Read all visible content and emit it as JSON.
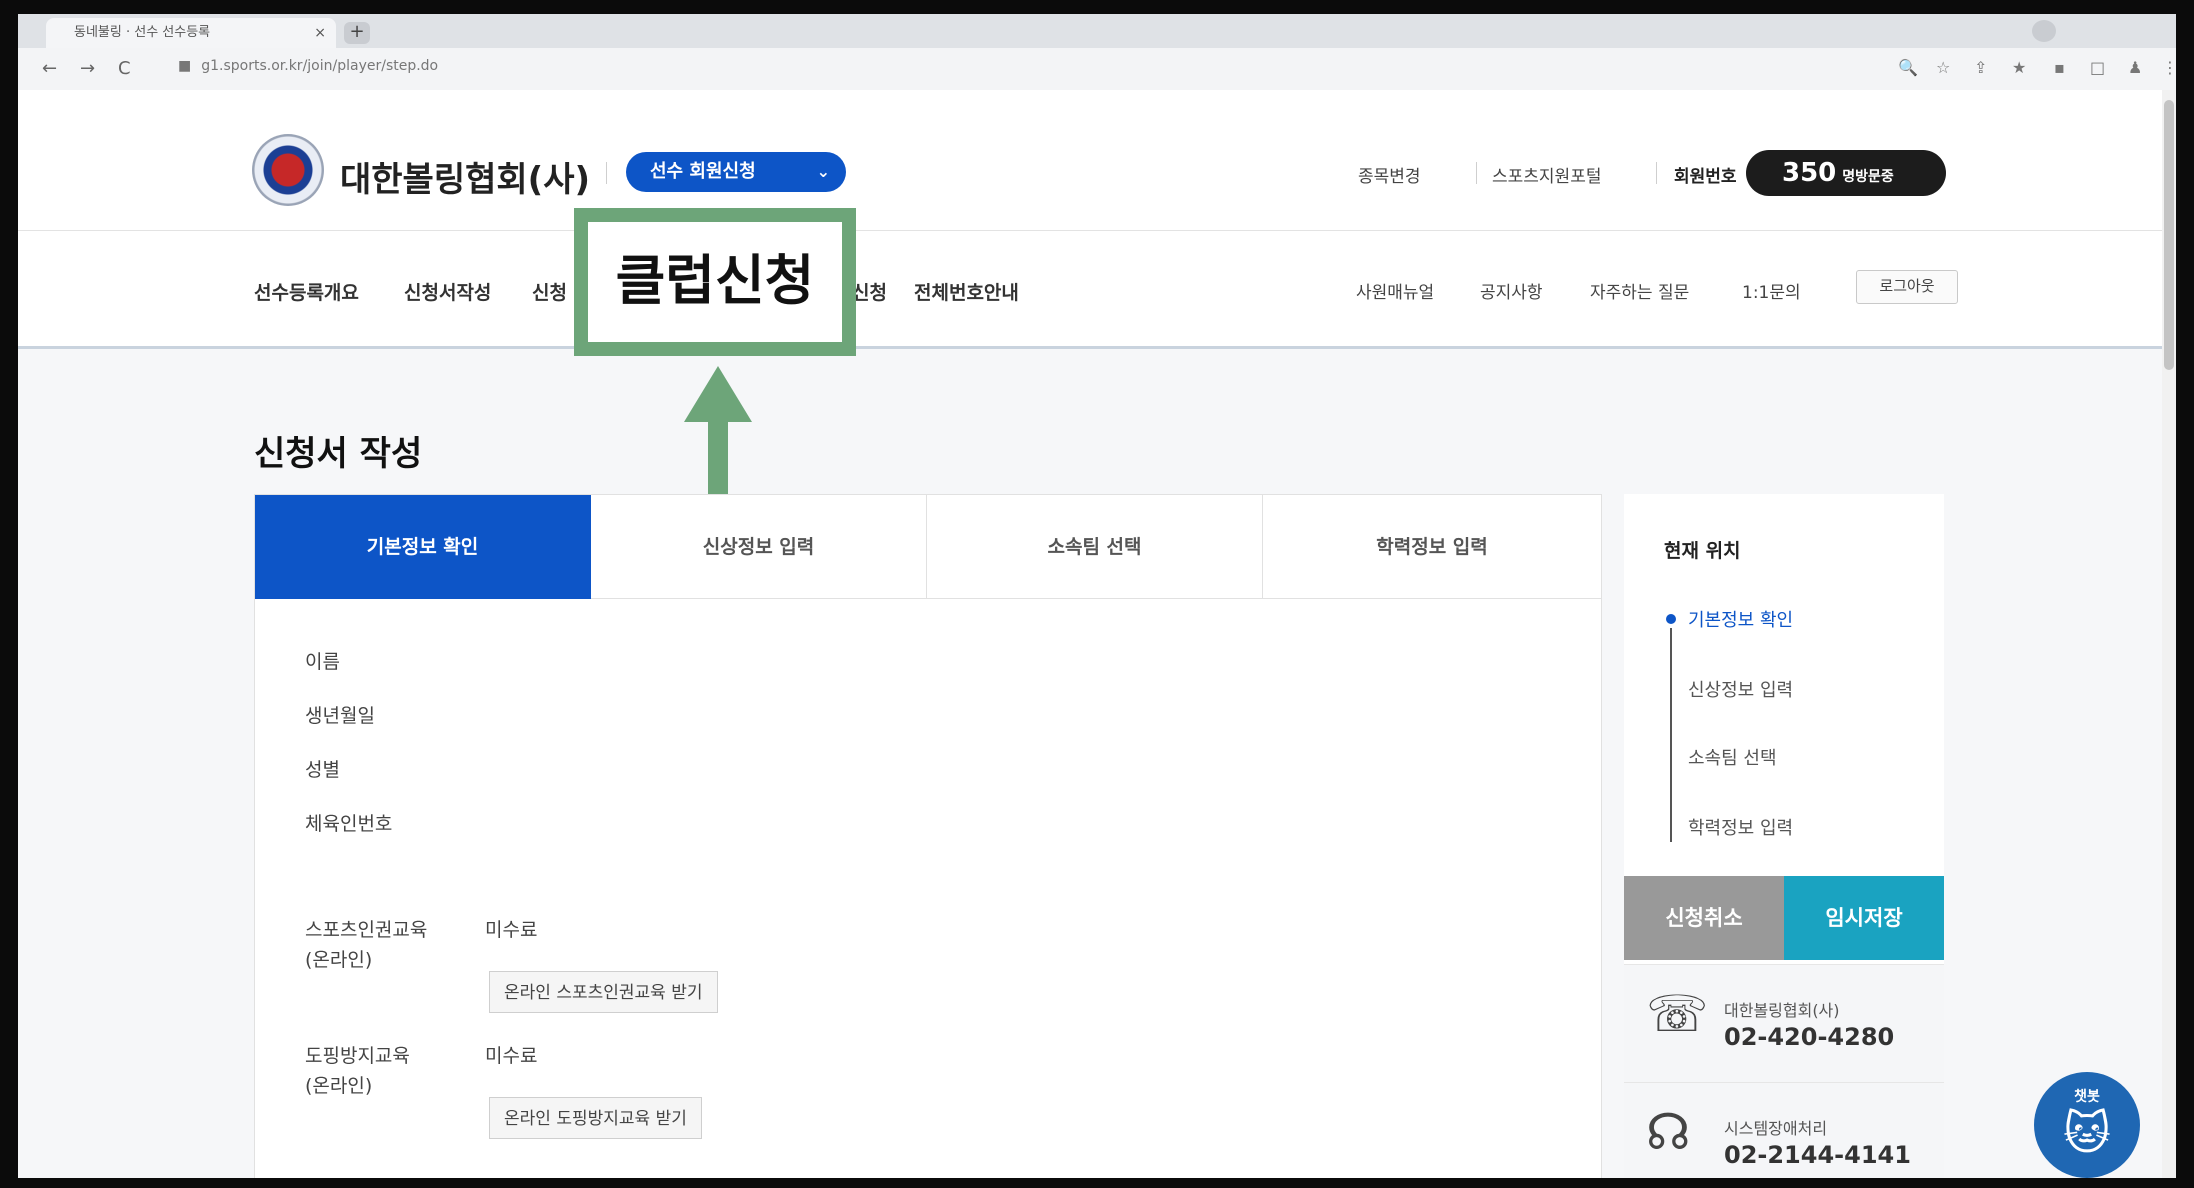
{
  "browser": {
    "tab_title": "동네불링 · 선수 선수등록",
    "tab_close": "×",
    "new_tab": "+",
    "back": "←",
    "forward": "→",
    "reload": "C",
    "lock": "■",
    "url": "g1.sports.or.kr/join/player/step.do",
    "toolbar_icons": [
      "🔍",
      "☆",
      "⇪",
      "★",
      "▪",
      "□",
      "♟",
      "⋮"
    ]
  },
  "header": {
    "site_title": "대한볼링협회(사)",
    "member_select": "선수 회원신청",
    "member_select_chevron": "⌄",
    "util_links": [
      "종목변경",
      "스포츠지원포털"
    ],
    "member_label": "회원번호",
    "visit_count": "350",
    "visit_label": "명방문중"
  },
  "nav": {
    "items": [
      "선수등록개요",
      "신청서작성",
      "신청",
      "신청",
      "전체번호안내"
    ],
    "right_links": [
      "사원매뉴얼",
      "공지사항",
      "자주하는 질문",
      "1:1문의"
    ],
    "logout": "로그아웃"
  },
  "callout": {
    "text": "클럽신청"
  },
  "page_heading": "신청서 작성",
  "steps": [
    "기본정보 확인",
    "신상정보 입력",
    "소속팀 선택",
    "학력정보 입력"
  ],
  "form": {
    "fields": [
      "이름",
      "생년월일",
      "성별",
      "체육인번호"
    ],
    "sports_edu": {
      "label": "스포츠인권교육",
      "sub": "(온라인)",
      "status": "미수료",
      "button": "온라인 스포츠인권교육 받기"
    },
    "doping_edu": {
      "label": "도핑방지교육",
      "sub": "(온라인)",
      "status": "미수료",
      "button": "온라인 도핑방지교육 받기"
    }
  },
  "sidebar": {
    "title": "현재 위치",
    "steps": [
      "기본정보 확인",
      "신상정보 입력",
      "소속팀 선택",
      "학력정보 입력"
    ],
    "cancel": "신청취소",
    "save": "임시저장",
    "contacts": [
      {
        "icon": "☏",
        "name": "대한볼링협회(사)",
        "phone": "02-420-4280"
      },
      {
        "icon": "☊",
        "name": "시스템장애처리",
        "phone": "02-2144-4141"
      }
    ]
  },
  "chatbot": {
    "label": "챗봇",
    "face": "🐱"
  },
  "colors": {
    "primary": "#0d55c7",
    "accent": "#1aa3c1",
    "highlight": "#6da579"
  }
}
